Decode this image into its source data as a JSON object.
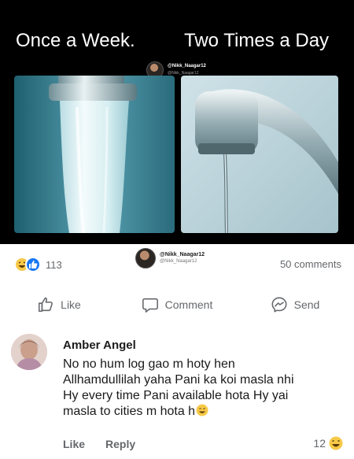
{
  "meme": {
    "caption_left": "Once a Week.",
    "caption_right": "Two Times a Day",
    "watermark_name": "@Nikk_Naagar12",
    "watermark_handle": "@Nikk_Naagar12"
  },
  "post": {
    "reaction_count": "113",
    "comments_count": "50 comments",
    "reactions": [
      "haha-icon",
      "like-icon"
    ],
    "watermark_name": "@Nikk_Naagar12",
    "watermark_handle": "@Nikk_Naagar12"
  },
  "actions": {
    "like": "Like",
    "comment": "Comment",
    "send": "Send"
  },
  "comment": {
    "author": "Amber Angel",
    "lines": [
      "No no hum log gao m hoty hen",
      "Allhamdullilah yaha Pani ka koi masla nhi",
      "Hy every time Pani available hota Hy yai",
      "masla to cities m hota h"
    ],
    "like_label": "Like",
    "reply_label": "Reply",
    "reaction_count": "12"
  },
  "colors": {
    "like_blue": "#1877f2",
    "haha_yellow": "#f7c948",
    "secondary_text": "#65676b"
  }
}
